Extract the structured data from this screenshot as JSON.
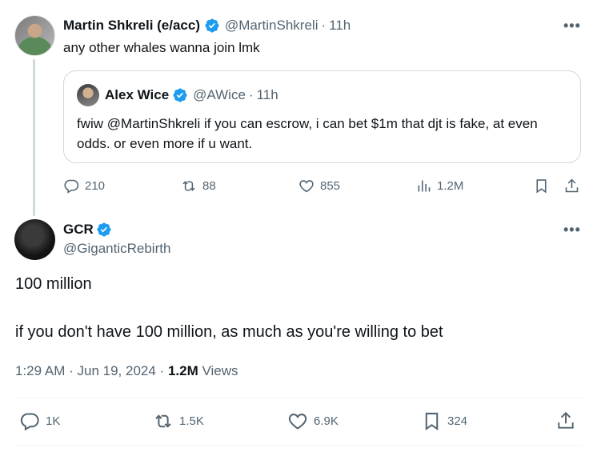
{
  "parent": {
    "name": "Martin Shkreli (e/acc)",
    "handle": "@MartinShkreli",
    "time": "11h",
    "text": "any other whales wanna join lmk",
    "quote": {
      "name": "Alex Wice",
      "handle": "@AWice",
      "time": "11h",
      "text": "fwiw @MartinShkreli  if you can escrow, i can bet $1m that djt is fake, at even odds.  or even more if u want."
    },
    "stats": {
      "replies": "210",
      "reposts": "88",
      "likes": "855",
      "views": "1.2M"
    }
  },
  "main": {
    "name": "GCR",
    "handle": "@GiganticRebirth",
    "line1": "100 million",
    "line2": "if you don't have 100 million, as much as you're willing to bet",
    "time": "1:29 AM",
    "date": "Jun 19, 2024",
    "views_count": "1.2M",
    "views_label": "Views",
    "stats": {
      "replies": "1K",
      "reposts": "1.5K",
      "likes": "6.9K",
      "bookmarks": "324"
    }
  },
  "separator": "·",
  "more": "•••",
  "colors": {
    "verified": "#1d9bf0",
    "muted": "#536471",
    "text": "#0f1419",
    "border": "#cfd9de"
  }
}
